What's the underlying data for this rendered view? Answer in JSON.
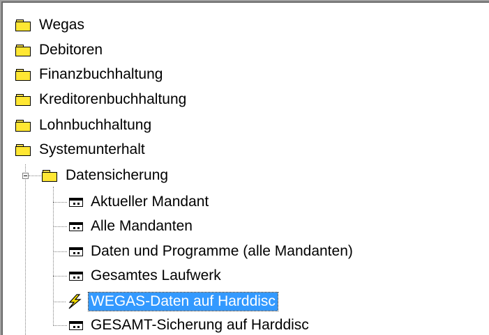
{
  "tree": {
    "root_items": [
      {
        "label": "Wegas",
        "icon": "folder-icon"
      },
      {
        "label": "Debitoren",
        "icon": "folder-icon"
      },
      {
        "label": "Finanzbuchhaltung",
        "icon": "folder-icon"
      },
      {
        "label": "Kreditorenbuchhaltung",
        "icon": "folder-icon"
      },
      {
        "label": "Lohnbuchhaltung",
        "icon": "folder-icon"
      },
      {
        "label": "Systemunterhalt",
        "icon": "folder-icon"
      }
    ],
    "datensicherung": {
      "label": "Datensicherung",
      "icon": "folder-icon",
      "expanded": true,
      "children": [
        {
          "label": "Aktueller Mandant",
          "icon": "dialog-window-icon"
        },
        {
          "label": "Alle Mandanten",
          "icon": "dialog-window-icon"
        },
        {
          "label": "Daten und Programme (alle Mandanten)",
          "icon": "dialog-window-icon"
        },
        {
          "label": "Gesamtes Laufwerk",
          "icon": "dialog-window-icon"
        },
        {
          "label": "WEGAS-Daten auf Harddisc",
          "icon": "lightning-bolt-icon",
          "selected": true
        },
        {
          "label": "GESAMT-Sicherung auf Harddisc",
          "icon": "dialog-window-icon"
        }
      ]
    },
    "colors": {
      "selection": "#3399ff",
      "folder": "#ffe733",
      "bolt": "#ffe400"
    }
  }
}
